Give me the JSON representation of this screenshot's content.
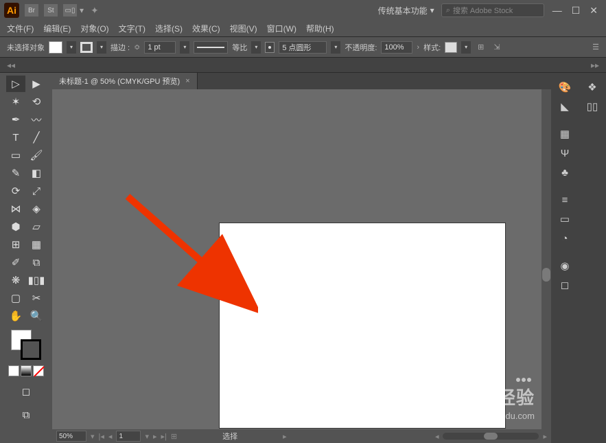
{
  "title": {
    "workspace": "传统基本功能",
    "search_placeholder": "搜索 Adobe Stock"
  },
  "menu": {
    "file": "文件(F)",
    "edit": "编辑(E)",
    "object": "对象(O)",
    "text": "文字(T)",
    "select": "选择(S)",
    "effect": "效果(C)",
    "view": "视图(V)",
    "window": "窗口(W)",
    "help": "帮助(H)"
  },
  "ctrl": {
    "nosel": "未选择对象",
    "stroke_lbl": "描边 :",
    "stroke_val": "1 pt",
    "uniform": "等比",
    "profile": "5 点圆形",
    "opacity_lbl": "不透明度:",
    "opacity_val": "100%",
    "style_lbl": "样式:"
  },
  "doc": {
    "tab": "未标题-1 @ 50% (CMYK/GPU 预览)",
    "close": "×"
  },
  "status": {
    "zoom": "50%",
    "page": "1",
    "tool": "选择"
  },
  "watermark": {
    "brand": "Baidu 经验",
    "url": "jingyan.baidu.com"
  }
}
